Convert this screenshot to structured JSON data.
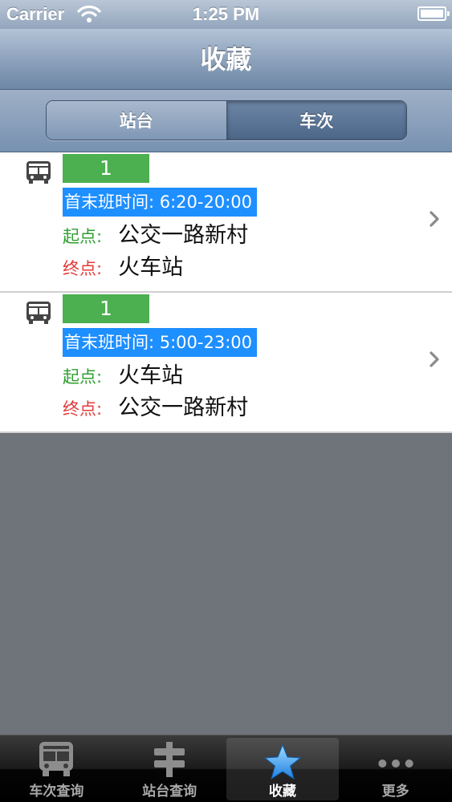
{
  "status_bar": {
    "carrier": "Carrier",
    "time": "1:25 PM"
  },
  "nav": {
    "title": "收藏"
  },
  "segments": [
    {
      "label": "站台",
      "selected": false
    },
    {
      "label": "车次",
      "selected": true
    }
  ],
  "colors": {
    "route_badge": "#4caf50",
    "hours_highlight": "#1e8fff",
    "start_label": "#2f9e2f",
    "end_label": "#e23b3b"
  },
  "favorites": [
    {
      "icon": "bus-icon",
      "route": "1",
      "hours": "首末班时间: 6:20-20:00",
      "start_label": "起点:",
      "start": "公交一路新村",
      "end_label": "终点:",
      "end": "火车站"
    },
    {
      "icon": "bus-icon",
      "route": "1",
      "hours": "首末班时间: 5:00-23:00",
      "start_label": "起点:",
      "start": "火车站",
      "end_label": "终点:",
      "end": "公交一路新村"
    }
  ],
  "tabs": [
    {
      "label": "车次查询",
      "icon": "bus-icon",
      "selected": false
    },
    {
      "label": "站台查询",
      "icon": "bus-stop-sign-icon",
      "selected": false
    },
    {
      "label": "收藏",
      "icon": "star-icon",
      "selected": true
    },
    {
      "label": "更多",
      "icon": "more-dots-icon",
      "selected": false
    }
  ]
}
